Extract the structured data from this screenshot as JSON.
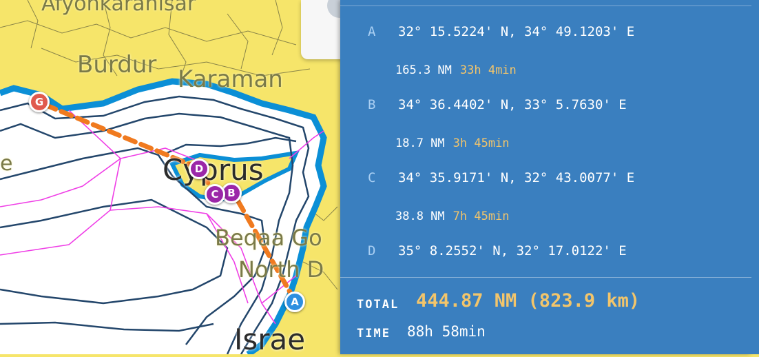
{
  "map": {
    "places": [
      {
        "id": "afyonkarahisar",
        "label": "Afyonkarahisar"
      },
      {
        "id": "burdur",
        "label": "Burdur"
      },
      {
        "id": "karaman",
        "label": "Karaman"
      },
      {
        "id": "cyprus",
        "label": "Cyprus"
      },
      {
        "id": "beqaa",
        "label": "Beqaa Go"
      },
      {
        "id": "north",
        "label": "North D"
      },
      {
        "id": "israel",
        "label": "Israe"
      },
      {
        "id": "edge-e",
        "label": "e"
      }
    ],
    "markers": [
      {
        "id": "A",
        "label": "A",
        "color": "#2d8fe0"
      },
      {
        "id": "B",
        "label": "B",
        "color": "#9b27a8"
      },
      {
        "id": "C",
        "label": "C",
        "color": "#9b27a8"
      },
      {
        "id": "D",
        "label": "D",
        "color": "#9b27a8"
      },
      {
        "id": "G",
        "label": "G",
        "color": "#e05a4e"
      }
    ],
    "route_color": "#f07a1f",
    "land_color": "#f6e56a",
    "sea_color": "#ffffff",
    "coast_color": "#0b8fd6",
    "contour_color": "#23466b",
    "lane_color": "#ef3ee6"
  },
  "panel": {
    "waypoints": [
      {
        "letter": "A",
        "coords": "32° 15.5224' N, 34° 49.1203' E"
      },
      {
        "letter": "B",
        "coords": "34° 36.4402' N, 33° 5.7630' E"
      },
      {
        "letter": "C",
        "coords": "34° 35.9171' N, 32° 43.0077' E"
      },
      {
        "letter": "D",
        "coords": "35° 8.2552' N, 32° 17.0122' E"
      }
    ],
    "legs": [
      {
        "distance": "165.3 NM",
        "time": "33h 4min"
      },
      {
        "distance": "18.7 NM",
        "time": "3h 45min"
      },
      {
        "distance": "38.8 NM",
        "time": "7h 45min"
      }
    ],
    "total_label": "TOTAL",
    "total_value": "444.87 NM (823.9 km)",
    "time_label": "TIME",
    "time_value": "88h 58min",
    "accent_color": "#f2c56b",
    "background_color": "#3a7fbf"
  }
}
